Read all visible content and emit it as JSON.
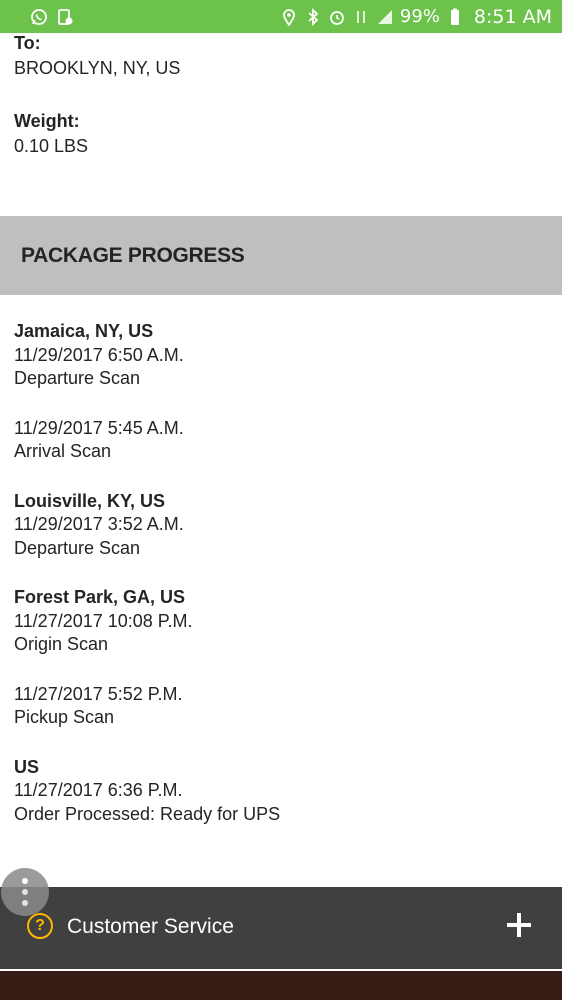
{
  "status_bar": {
    "battery": "99%",
    "time": "8:51 AM",
    "left_icons": [
      "whatsapp-icon",
      "file-download-icon"
    ],
    "right_icons": [
      "location-icon",
      "bluetooth-icon",
      "alarm-icon",
      "data-icon",
      "signal-icon",
      "battery-icon"
    ]
  },
  "shipment": {
    "to_label": "To:",
    "to_value": "BROOKLYN, NY, US",
    "weight_label": "Weight:",
    "weight_value": "0.10 LBS"
  },
  "progress": {
    "title": "PACKAGE PROGRESS",
    "events": [
      {
        "location": "Jamaica, NY, US",
        "datetime": "11/29/2017 6:50 A.M.",
        "description": "Departure Scan"
      },
      {
        "location": "",
        "datetime": "11/29/2017 5:45 A.M.",
        "description": "Arrival Scan"
      },
      {
        "location": "Louisville, KY, US",
        "datetime": "11/29/2017 3:52 A.M.",
        "description": "Departure Scan"
      },
      {
        "location": "Forest Park, GA, US",
        "datetime": "11/27/2017 10:08 P.M.",
        "description": "Origin Scan"
      },
      {
        "location": "",
        "datetime": "11/27/2017 5:52 P.M.",
        "description": "Pickup Scan"
      },
      {
        "location": "US",
        "datetime": "11/27/2017 6:36 P.M.",
        "description": "Order Processed: Ready for UPS"
      }
    ]
  },
  "customer_service": {
    "help_icon": "?",
    "label": "Customer Service",
    "expand_icon": "plus-icon"
  },
  "colors": {
    "status_bar": "#6cc24a",
    "section_header": "#bfbfbf",
    "cs_bar": "#404040",
    "accent": "#ffb500",
    "brand_brown": "#351c15"
  }
}
